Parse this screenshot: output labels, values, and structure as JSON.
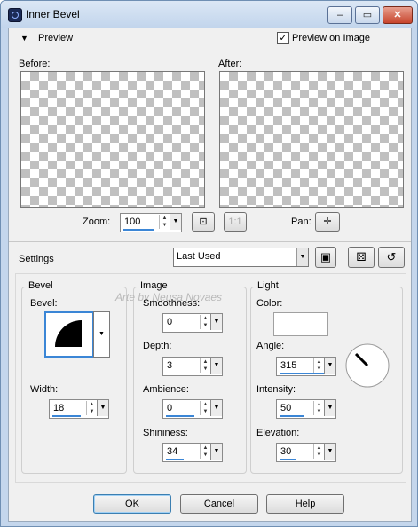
{
  "window": {
    "title": "Inner Bevel",
    "minimize": "–",
    "maximize": "▭",
    "close": "✕"
  },
  "preview": {
    "toggle_label": "Preview",
    "checkbox_label": "Preview on Image",
    "checkbox_checked": true,
    "before_label": "Before:",
    "after_label": "After:",
    "zoom_label": "Zoom:",
    "zoom_value": "100",
    "pan_label": "Pan:"
  },
  "settings": {
    "label": "Settings",
    "preset_value": "Last Used"
  },
  "bevel": {
    "group_label": "Bevel",
    "bevel_label": "Bevel:",
    "width_label": "Width:",
    "width_value": "18"
  },
  "image": {
    "group_label": "Image",
    "smoothness_label": "Smoothness:",
    "smoothness_value": "0",
    "depth_label": "Depth:",
    "depth_value": "3",
    "ambience_label": "Ambience:",
    "ambience_value": "0",
    "shininess_label": "Shininess:",
    "shininess_value": "34"
  },
  "light": {
    "group_label": "Light",
    "color_label": "Color:",
    "color_value": "#ffffff",
    "angle_label": "Angle:",
    "angle_value": "315",
    "intensity_label": "Intensity:",
    "intensity_value": "50",
    "elevation_label": "Elevation:",
    "elevation_value": "30"
  },
  "watermark": "Arte by Neusa Novaes",
  "buttons": {
    "ok": "OK",
    "cancel": "Cancel",
    "help": "Help"
  },
  "icons": {
    "zoom_fit": "fit-window-icon",
    "zoom_actual": "actual-size-icon",
    "pan": "pan-crosshair-icon",
    "save": "save-preset-icon",
    "randomize": "dice-icon",
    "reset": "reset-icon"
  }
}
